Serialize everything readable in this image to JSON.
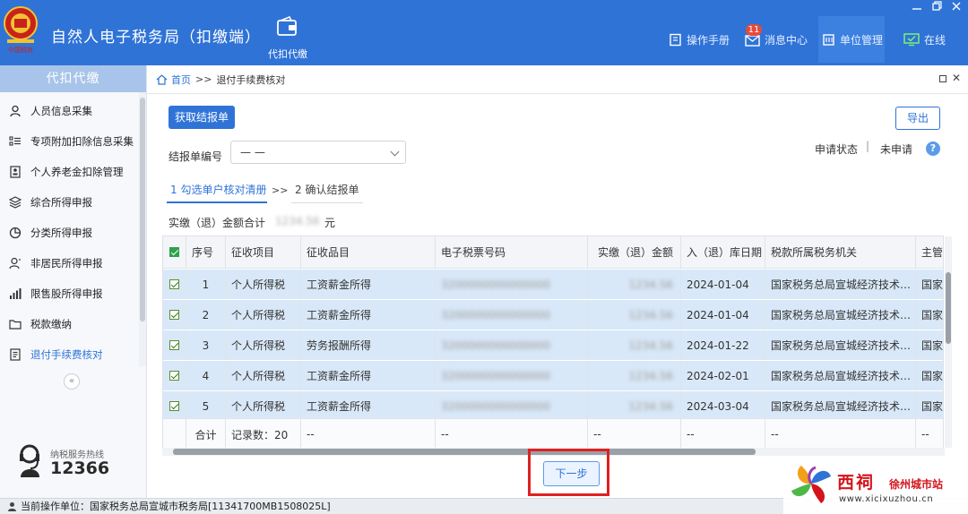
{
  "app": {
    "title": "自然人电子税务局（扣缴端）",
    "nav_active_label": "代扣代缴",
    "manual_label": "操作手册",
    "messages_label": "消息中心",
    "messages_badge": "11",
    "unit_mgmt_label": "单位管理",
    "online_label": "在线",
    "accent_color": "#2f73d7"
  },
  "sidebar": {
    "header": "代扣代缴",
    "items": [
      {
        "label": "人员信息采集",
        "icon": "person-icon"
      },
      {
        "label": "专项附加扣除信息采集",
        "icon": "list-icon"
      },
      {
        "label": "个人养老金扣除管理",
        "icon": "id-card-icon"
      },
      {
        "label": "综合所得申报",
        "icon": "layers-icon"
      },
      {
        "label": "分类所得申报",
        "icon": "pie-icon"
      },
      {
        "label": "非居民所得申报",
        "icon": "person-outline-icon"
      },
      {
        "label": "限售股所得申报",
        "icon": "bar-chart-icon"
      },
      {
        "label": "税款缴纳",
        "icon": "folder-icon"
      },
      {
        "label": "退付手续费核对",
        "icon": "document-icon",
        "active": true
      }
    ],
    "collapse_label": "«",
    "hotline_label": "纳税服务热线",
    "hotline_number": "12366"
  },
  "breadcrumb": {
    "home": "首页",
    "sep": ">>",
    "current": "退付手续费核对"
  },
  "main": {
    "fetch_button": "获取结报单",
    "export_button": "导出",
    "form_label": "结报单编号",
    "form_value": "— —",
    "status_label": "申请状态",
    "status_divider": "|",
    "status_value": "未申请",
    "help": "?",
    "step1": "1 勾选单户核对清册",
    "step_arrow": ">>",
    "step2": "2 确认结报单",
    "sum_label": "实缴（退）金额合计",
    "sum_value": "1234.56",
    "sum_unit": "元",
    "next_button": "下一步"
  },
  "table": {
    "headers": [
      "序号",
      "征收项目",
      "征收品目",
      "电子税票号码",
      "实缴（退）金额",
      "入（退）库日期",
      "税款所属税务机关",
      "主管"
    ],
    "rows": [
      {
        "no": "1",
        "item": "个人所得税",
        "subitem": "工资薪金所得",
        "ticket": "3200000000000000",
        "amount": "1234.56",
        "date": "2024-01-04",
        "office": "国家税务总局宣城经济技术…",
        "main": "国家"
      },
      {
        "no": "2",
        "item": "个人所得税",
        "subitem": "工资薪金所得",
        "ticket": "3200000000000000",
        "amount": "1234.56",
        "date": "2024-01-04",
        "office": "国家税务总局宣城经济技术…",
        "main": "国家"
      },
      {
        "no": "3",
        "item": "个人所得税",
        "subitem": "劳务报酬所得",
        "ticket": "3200000000000000",
        "amount": "1234.56",
        "date": "2024-01-22",
        "office": "国家税务总局宣城经济技术…",
        "main": "国家"
      },
      {
        "no": "4",
        "item": "个人所得税",
        "subitem": "工资薪金所得",
        "ticket": "3200000000000000",
        "amount": "1234.56",
        "date": "2024-02-01",
        "office": "国家税务总局宣城经济技术…",
        "main": "国家"
      },
      {
        "no": "5",
        "item": "个人所得税",
        "subitem": "工资薪金所得",
        "ticket": "3200000000000000",
        "amount": "1234.56",
        "date": "2024-03-04",
        "office": "国家税务总局宣城经济技术…",
        "main": "国家"
      }
    ],
    "footer": {
      "total_label": "合计",
      "count": "记录数：20",
      "dash": "--"
    }
  },
  "statusbar": {
    "text": "当前操作单位：国家税务总局宣城市税务局[11341700MB1508025L]"
  },
  "watermark": {
    "title": "西祠",
    "city": "徐州城市站",
    "url": "www.xicixuzhou.cn"
  }
}
